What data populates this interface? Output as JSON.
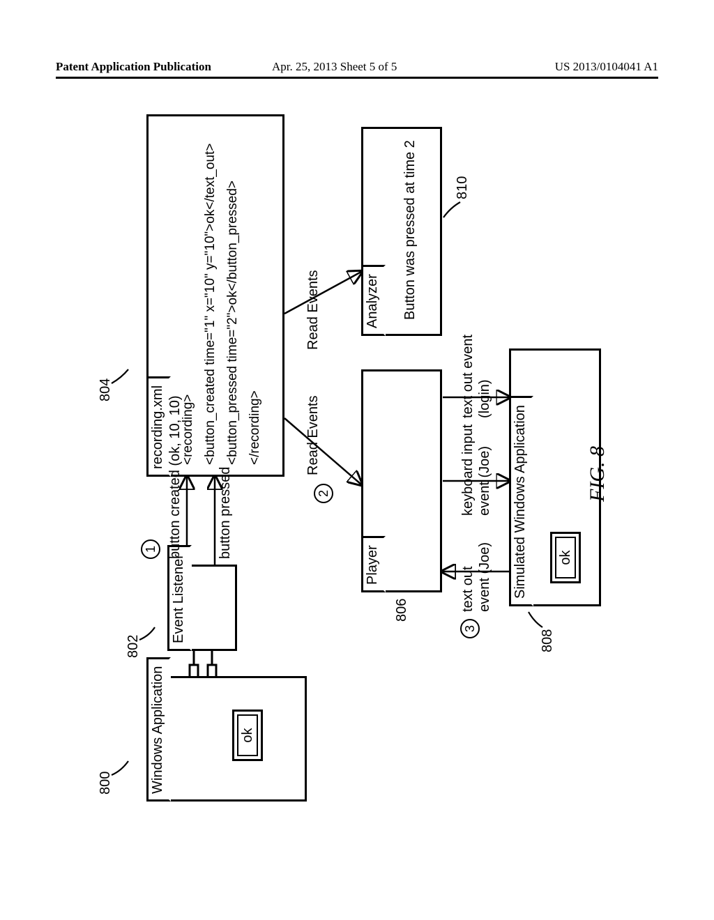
{
  "header": {
    "left": "Patent Application Publication",
    "center": "Apr. 25, 2013  Sheet 5 of 5",
    "right": "US 2013/0104041 A1"
  },
  "figure_label": "FIG. 8",
  "refs": {
    "r800": "800",
    "r802": "802",
    "r804": "804",
    "r806": "806",
    "r808": "808",
    "r810": "810"
  },
  "steps": {
    "s1": "1",
    "s2": "2",
    "s3": "3"
  },
  "boxes": {
    "win_app": "Windows Application",
    "event_listener": "Event Listener",
    "recording_file": "recording.xml",
    "player": "Player",
    "analyzer": "Analyzer",
    "sim_app": "Simulated Windows Application",
    "ok": "ok"
  },
  "arrows": {
    "a1": "button created (ok, 10, 10)",
    "a2": "button pressed",
    "read_events_1": "Read Events",
    "read_events_2": "Read Events",
    "text_out_joe": "text out",
    "text_out_joe2": "event (Joe)",
    "kb_in_joe": "keyboard input",
    "kb_in_joe2": "event (Joe)",
    "text_out_login": "text out event",
    "text_out_login2": "(login)"
  },
  "analyzer_msg": "Button was pressed at time 2",
  "xml": {
    "l1": "<recording>",
    "l2": "<button_created time=\"1\" x=\"10\" y=\"10\">ok</text_out>",
    "l3": "<button_pressed time=\"2\">ok</button_pressed>",
    "l4": "</recording>"
  }
}
